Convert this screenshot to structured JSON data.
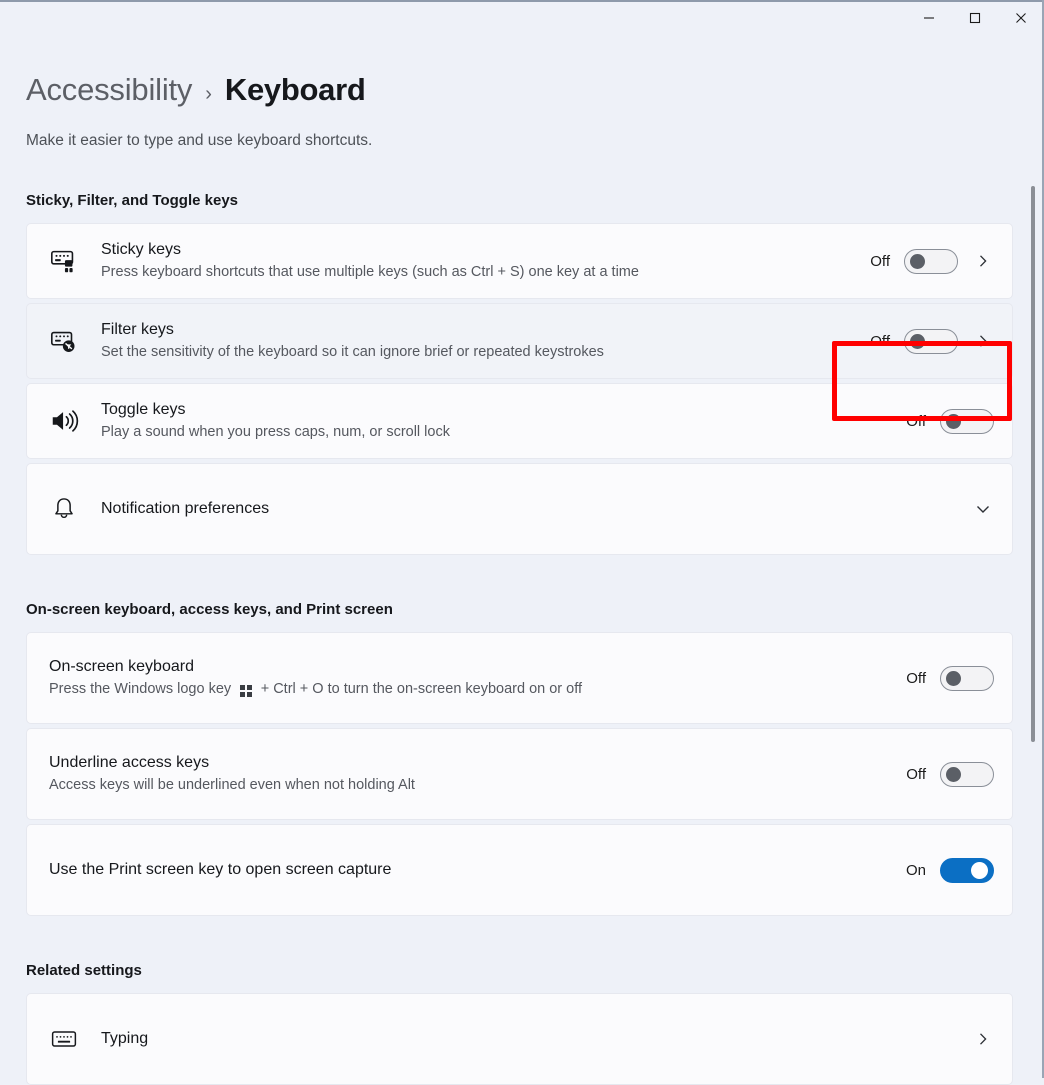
{
  "window": {
    "minimize_label": "Minimize",
    "maximize_label": "Maximize",
    "close_label": "Close"
  },
  "breadcrumb": {
    "root": "Accessibility",
    "separator": "›",
    "current": "Keyboard"
  },
  "subtitle": "Make it easier to type and use keyboard shortcuts.",
  "sections": [
    {
      "header": "Sticky, Filter, and Toggle keys",
      "rows": [
        {
          "name": "sticky-keys",
          "icon": "keyboard-sticky-icon",
          "title": "Sticky keys",
          "desc": "Press keyboard shortcuts that use multiple keys (such as Ctrl + S) one key at a time",
          "state": "Off",
          "toggle_on": false,
          "chevron": "chevron-right",
          "highlighted": false
        },
        {
          "name": "filter-keys",
          "icon": "keyboard-filter-icon",
          "title": "Filter keys",
          "desc": "Set the sensitivity of the keyboard so it can ignore brief or repeated keystrokes",
          "state": "Off",
          "toggle_on": false,
          "chevron": "chevron-right",
          "highlighted": true
        },
        {
          "name": "toggle-keys",
          "icon": "speaker-sound-icon",
          "title": "Toggle keys",
          "desc": "Play a sound when you press caps, num, or scroll lock",
          "state": "Off",
          "toggle_on": false,
          "chevron": "",
          "highlighted": false
        },
        {
          "name": "notification-preferences",
          "icon": "bell-icon",
          "title": "Notification preferences",
          "desc": "",
          "state": "",
          "toggle_on": null,
          "chevron": "chevron-down",
          "highlighted": false
        }
      ]
    },
    {
      "header": "On-screen keyboard, access keys, and Print screen",
      "rows": [
        {
          "name": "on-screen-keyboard",
          "icon": "",
          "title": "On-screen keyboard",
          "desc_before": "Press the Windows logo key ",
          "desc_glyph": "windows-logo-glyph",
          "desc_after": " + Ctrl + O to turn the on-screen keyboard on or off",
          "state": "Off",
          "toggle_on": false,
          "chevron": "",
          "highlighted": false
        },
        {
          "name": "underline-access-keys",
          "icon": "",
          "title": "Underline access keys",
          "desc": "Access keys will be underlined even when not holding Alt",
          "state": "Off",
          "toggle_on": false,
          "chevron": "",
          "highlighted": false
        },
        {
          "name": "print-screen-capture",
          "icon": "",
          "title": "Use the Print screen key to open screen capture",
          "desc": "",
          "state": "On",
          "toggle_on": true,
          "chevron": "",
          "highlighted": false
        }
      ]
    },
    {
      "header": "Related settings",
      "rows": [
        {
          "name": "typing",
          "icon": "keyboard-icon",
          "title": "Typing",
          "desc": "",
          "state": "",
          "toggle_on": null,
          "chevron": "chevron-right",
          "highlighted": false
        }
      ]
    }
  ],
  "colors": {
    "page_background": "#eef1f8",
    "card_background": "#fbfbfd",
    "card_hover_background": "#f1f3f8",
    "accent_on": "#0b6fc4",
    "highlight_border": "#ff0000"
  }
}
